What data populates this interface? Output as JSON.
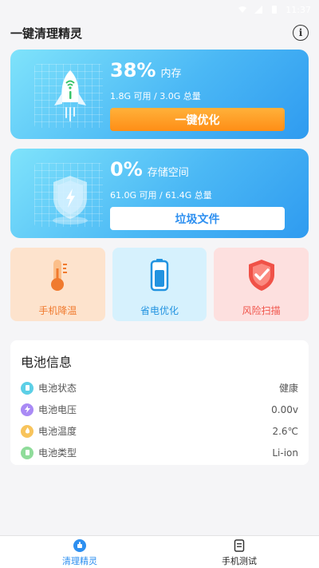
{
  "status_bar": {
    "time": "11:37"
  },
  "header": {
    "title": "一键清理精灵",
    "info_icon": "info-icon",
    "info_glyph": "i"
  },
  "memory_card": {
    "percent": "38%",
    "label": "内存",
    "detail": "1.8G 可用 / 3.0G 总量",
    "button": "一键优化",
    "icon": "rocket-icon"
  },
  "storage_card": {
    "percent": "0%",
    "label": "存储空间",
    "detail": "61.0G 可用 / 61.4G 总量",
    "button": "垃圾文件",
    "icon": "shield-icon"
  },
  "tiles": [
    {
      "label": "手机降温",
      "icon": "thermometer-icon",
      "color": "#f07a2e"
    },
    {
      "label": "省电优化",
      "icon": "battery-icon",
      "color": "#2293e0"
    },
    {
      "label": "风险扫描",
      "icon": "shield-check-icon",
      "color": "#f05248"
    }
  ],
  "battery_info": {
    "title": "电池信息",
    "rows": [
      {
        "name": "电池状态",
        "value": "健康",
        "icon": "battery-status-icon",
        "color": "#5ccfe6"
      },
      {
        "name": "电池电压",
        "value": "0.00v",
        "icon": "bolt-icon",
        "color": "#a98af5"
      },
      {
        "name": "电池温度",
        "value": "2.6℃",
        "icon": "flame-icon",
        "color": "#f8c45c"
      },
      {
        "name": "电池类型",
        "value": "Li-ion",
        "icon": "battery-type-icon",
        "color": "#8fdc9a"
      }
    ]
  },
  "tabbar": {
    "tabs": [
      {
        "label": "清理精灵",
        "icon": "clean-icon",
        "active": true
      },
      {
        "label": "手机测试",
        "icon": "document-icon",
        "active": false
      }
    ]
  },
  "colors": {
    "accent": "#2d8ff0",
    "orange": "#ff9a22",
    "card_blue": "#4bb8f5"
  }
}
